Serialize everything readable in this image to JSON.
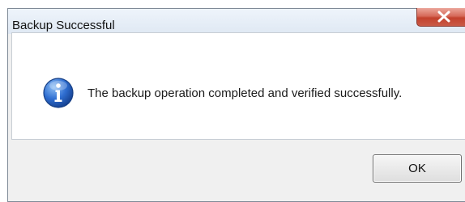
{
  "dialog": {
    "title": "Backup Successful",
    "message": "The backup operation completed and verified successfully.",
    "ok_label": "OK",
    "icon": "info-icon",
    "close_icon": "close-icon"
  },
  "colors": {
    "close_button": "#c3412d",
    "info_icon": "#1f5bb5",
    "dialog_background": "#f0f0f0",
    "content_background": "#ffffff"
  }
}
